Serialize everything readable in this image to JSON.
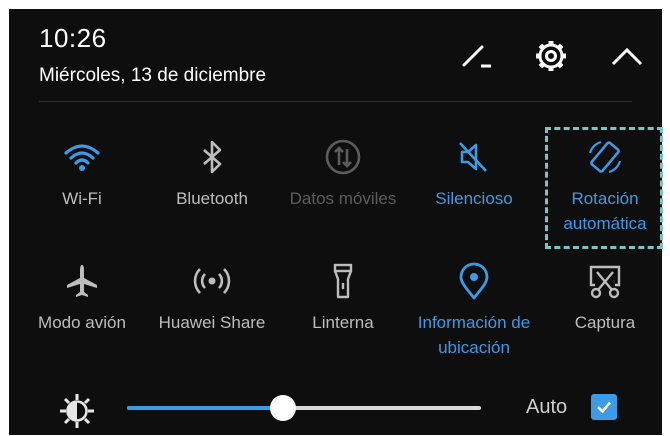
{
  "status": {
    "time": "10:26",
    "date": "Miércoles, 13 de diciembre"
  },
  "header_icons": [
    "edit-icon",
    "settings-gear-icon",
    "collapse-chevron-up-icon"
  ],
  "tiles": [
    {
      "label": "Wi-Fi",
      "icon": "wifi-icon",
      "state": "on"
    },
    {
      "label": "Bluetooth",
      "icon": "bluetooth-icon",
      "state": "off"
    },
    {
      "label": "Datos móviles",
      "icon": "mobile-data-icon",
      "state": "disabled"
    },
    {
      "label": "Silencioso",
      "icon": "silent-icon",
      "state": "on"
    },
    {
      "label": "Rotación automática",
      "icon": "auto-rotate-icon",
      "state": "on"
    },
    {
      "label": "Modo avión",
      "icon": "airplane-icon",
      "state": "off"
    },
    {
      "label": "Huawei Share",
      "icon": "huawei-share-icon",
      "state": "off"
    },
    {
      "label": "Linterna",
      "icon": "flashlight-icon",
      "state": "off"
    },
    {
      "label": "Información de ubicación",
      "icon": "location-icon",
      "state": "on"
    },
    {
      "label": "Captura",
      "icon": "screenshot-icon",
      "state": "off"
    }
  ],
  "brightness": {
    "level": 0.44,
    "auto_label": "Auto",
    "auto_checked": true
  },
  "colors": {
    "accent": "#3c9be6",
    "background": "#0e0e0e",
    "label_off": "#bdbdbd",
    "label_disabled": "#5c5c5c",
    "highlight": "#7ec3c3"
  }
}
